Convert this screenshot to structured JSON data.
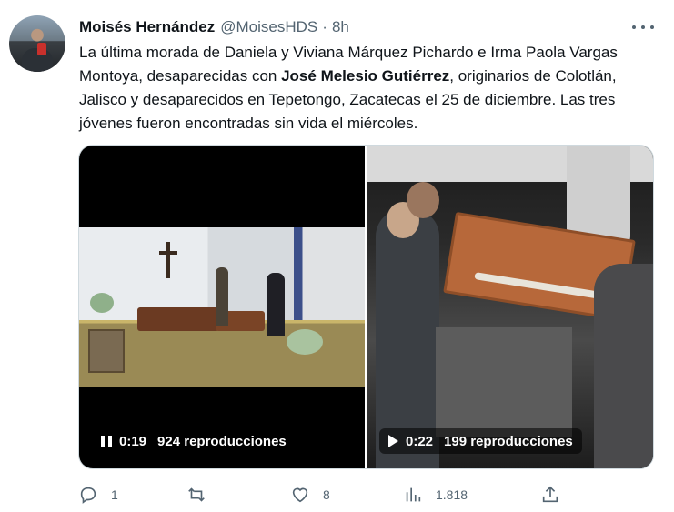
{
  "author": {
    "display_name": "Moisés Hernández",
    "handle": "@MoisesHDS",
    "separator": "·",
    "time": "8h"
  },
  "tweet": {
    "text_part1": "La última morada de Daniela y Viviana Márquez Pichardo e Irma Paola Vargas Montoya, desaparecidas con ",
    "text_bold": "José Melesio Gutiérrez",
    "text_part2": ", originarios de Colotlán, Jalisco y desaparecidos en Tepetongo, Zacatecas el 25 de diciembre. Las tres jóvenes fueron encontradas sin vida el miércoles."
  },
  "media": {
    "videos": [
      {
        "state": "pause-icon",
        "duration": "0:19",
        "views": "924 reproducciones"
      },
      {
        "state": "play-icon",
        "duration": "0:22",
        "views": "199 reproducciones"
      }
    ]
  },
  "actions": {
    "reply": {
      "icon": "reply-icon",
      "count": "1"
    },
    "retweet": {
      "icon": "retweet-icon",
      "count": ""
    },
    "like": {
      "icon": "heart-icon",
      "count": "8"
    },
    "views": {
      "icon": "analytics-icon",
      "count": "1.818"
    },
    "share": {
      "icon": "share-icon"
    }
  },
  "colors": {
    "text": "#0f1419",
    "secondary": "#536471",
    "border": "#cfd9de"
  }
}
